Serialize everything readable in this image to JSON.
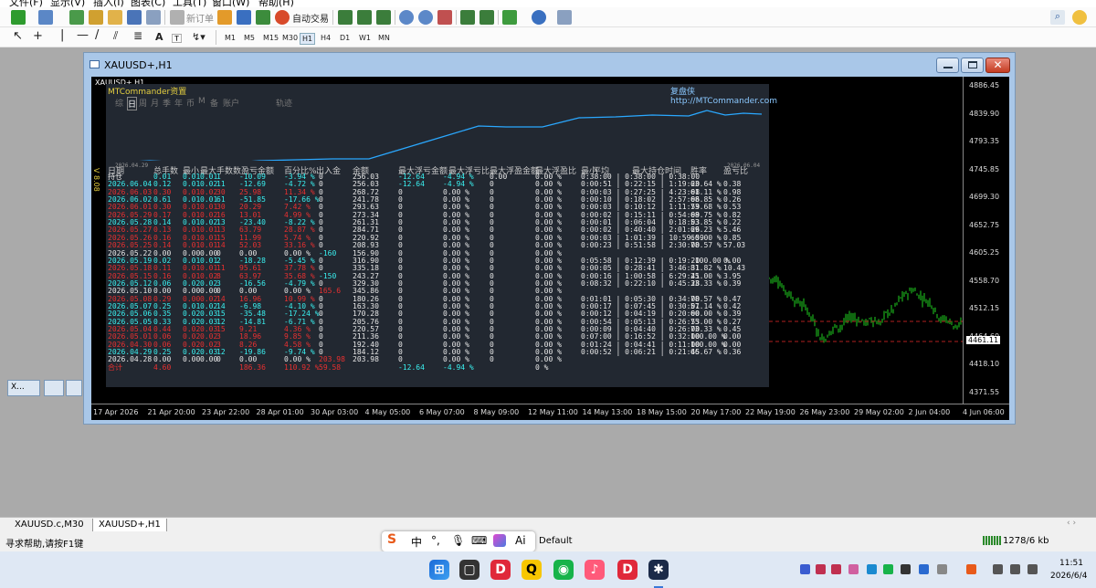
{
  "menu": [
    "文件(F)",
    "显示(V)",
    "插入(I)",
    "图表(C)",
    "工具(T)",
    "窗口(W)",
    "帮助(H)"
  ],
  "toolbar": {
    "new_order": "新订单",
    "auto_trading": "自动交易",
    "timeframes": [
      "M1",
      "M5",
      "M15",
      "M30",
      "H1",
      "H4",
      "D1",
      "W1",
      "MN"
    ],
    "active_timeframe": "H1",
    "text_tool": "A"
  },
  "chart_window": {
    "title": "XAUUSD+,H1",
    "symbol_label": "XAUUSD+,H1"
  },
  "price_axis": [
    "4886.45",
    "4839.90",
    "4793.35",
    "4745.85",
    "4699.30",
    "4652.75",
    "4605.25",
    "4558.70",
    "4512.15",
    "4464.60",
    "4418.10",
    "4371.55"
  ],
  "price_marker": "4461.11",
  "time_axis": [
    "17 Apr 2026",
    "21 Apr 20:00",
    "23 Apr 22:00",
    "28 Apr 01:00",
    "30 Apr 03:00",
    "4 May 05:00",
    "6 May 07:00",
    "8 May 09:00",
    "12 May 11:00",
    "14 May 13:00",
    "18 May 15:00",
    "20 May 17:00",
    "22 May 19:00",
    "26 May 23:00",
    "29 May 02:00",
    "2 Jun 04:00",
    "4 Jun 06:00"
  ],
  "panel": {
    "title": "MTCommander资置",
    "brand": "复盘侠 http://MTCommander.com",
    "tabs": [
      "综",
      "日",
      "周",
      "月",
      "季",
      "年",
      "币",
      "M",
      "备",
      "账户",
      "轨迹"
    ],
    "curve_start": "2026.04.29",
    "curve_end": "2026.06.04",
    "headers": [
      "日期",
      "总手数",
      "最小",
      "最大",
      "手数",
      "数",
      "盈亏金额",
      "百分比%",
      "出入金",
      "余额",
      "最大浮亏金额",
      "最大浮亏比",
      "最大浮盈金额",
      "最大浮盈比",
      "最小",
      "平均",
      "最大持仓时间",
      "胜率",
      "盈亏比"
    ],
    "rows": [
      {
        "d": "持仓",
        "l": "0.01",
        "mn": "0.01",
        "mx": "0.01",
        "n": "1",
        "pl": "-10.09",
        "pct": "-3.94 %",
        "io": "0",
        "bal": "256.03",
        "fl": "-12.64",
        "flp": "-4.94 %",
        "fp": "0.00",
        "fpp": "0.00 %",
        "t": "0:38:00 | 0:38:00 | 0:38:00",
        "wr": "",
        "rr": "",
        "c": "c"
      },
      {
        "d": "2026.06.04",
        "l": "0.12",
        "mn": "0.01",
        "mx": "0.02",
        "n": "11",
        "pl": "-12.69",
        "pct": "-4.72 %",
        "io": "0",
        "bal": "256.03",
        "fl": "-12.64",
        "flp": "-4.94 %",
        "fp": "0",
        "fpp": "0.00 %",
        "t": "0:00:51 | 0:22:15 | 1:19:20",
        "wr": "63.64 %",
        "rr": "0.38",
        "c": "c"
      },
      {
        "d": "2026.06.03",
        "l": "0.30",
        "mn": "0.01",
        "mx": "0.02",
        "n": "30",
        "pl": "25.98",
        "pct": "11.34 %",
        "io": "0",
        "bal": "268.72",
        "fl": "0",
        "flp": "0.00 %",
        "fp": "0",
        "fpp": "0.00 %",
        "t": "0:00:03 | 0:27:25 | 4:23:08",
        "wr": "61.11 %",
        "rr": "0.98",
        "c": "r"
      },
      {
        "d": "2026.06.02",
        "l": "0.61",
        "mn": "0.01",
        "mx": "0.01",
        "n": "61",
        "pl": "-51.85",
        "pct": "-17.66 %",
        "io": "0",
        "bal": "241.78",
        "fl": "0",
        "flp": "0.00 %",
        "fp": "0",
        "fpp": "0.00 %",
        "t": "0:00:10 | 0:18:02 | 2:57:06",
        "wr": "68.85 %",
        "rr": "0.26",
        "c": "c"
      },
      {
        "d": "2026.06.01",
        "l": "0.30",
        "mn": "0.01",
        "mx": "0.01",
        "n": "30",
        "pl": "20.29",
        "pct": "7.42 %",
        "io": "0",
        "bal": "293.63",
        "fl": "0",
        "flp": "0.00 %",
        "fp": "0",
        "fpp": "0.00 %",
        "t": "0:00:03 | 0:10:12 | 1:11:59",
        "wr": "73.68 %",
        "rr": "0.53",
        "c": "r"
      },
      {
        "d": "2026.05.29",
        "l": "0.17",
        "mn": "0.01",
        "mx": "0.02",
        "n": "16",
        "pl": "13.01",
        "pct": "4.99 %",
        "io": "0",
        "bal": "273.34",
        "fl": "0",
        "flp": "0.00 %",
        "fp": "0",
        "fpp": "0.00 %",
        "t": "0:00:02 | 0:15:11 | 0:54:09",
        "wr": "68.75 %",
        "rr": "0.82",
        "c": "r"
      },
      {
        "d": "2026.05.28",
        "l": "0.14",
        "mn": "0.01",
        "mx": "0.02",
        "n": "13",
        "pl": "-23.40",
        "pct": "-8.22 %",
        "io": "0",
        "bal": "261.31",
        "fl": "0",
        "flp": "0.00 %",
        "fp": "0",
        "fpp": "0.00 %",
        "t": "0:00:01 | 0:06:04 | 0:18:03",
        "wr": "53.85 %",
        "rr": "0.22",
        "c": "c"
      },
      {
        "d": "2026.05.27",
        "l": "0.13",
        "mn": "0.01",
        "mx": "0.01",
        "n": "13",
        "pl": "63.79",
        "pct": "28.87 %",
        "io": "0",
        "bal": "284.71",
        "fl": "0",
        "flp": "0.00 %",
        "fp": "0",
        "fpp": "0.00 %",
        "t": "0:00:02 | 0:40:40 | 2:01:26",
        "wr": "69.23 %",
        "rr": "5.46",
        "c": "r"
      },
      {
        "d": "2026.05.26",
        "l": "0.16",
        "mn": "0.01",
        "mx": "0.01",
        "n": "15",
        "pl": "11.99",
        "pct": "5.74 %",
        "io": "0",
        "bal": "220.92",
        "fl": "0",
        "flp": "0.00 %",
        "fp": "0",
        "fpp": "0.00 %",
        "t": "0:00:03 | 1:01:39 | 10:59:59",
        "wr": "60.00 %",
        "rr": "0.85",
        "c": "r"
      },
      {
        "d": "2026.05.25",
        "l": "0.14",
        "mn": "0.01",
        "mx": "0.01",
        "n": "14",
        "pl": "52.03",
        "pct": "33.16 %",
        "io": "0",
        "bal": "208.93",
        "fl": "0",
        "flp": "0.00 %",
        "fp": "0",
        "fpp": "0.00 %",
        "t": "0:00:23 | 0:51:58 | 2:30:00",
        "wr": "78.57 %",
        "rr": "57.03",
        "c": "r"
      },
      {
        "d": "2026.05.22",
        "l": "0.00",
        "mn": "0.00",
        "mx": "0.00",
        "n": "0",
        "pl": "0.00",
        "pct": "0.00 %",
        "io": "-160",
        "bal": "156.90",
        "fl": "0",
        "flp": "0.00 %",
        "fp": "0",
        "fpp": "0.00 %",
        "t": "",
        "wr": "",
        "rr": "",
        "c": "w"
      },
      {
        "d": "2026.05.19",
        "l": "0.02",
        "mn": "0.01",
        "mx": "0.01",
        "n": "2",
        "pl": "-18.28",
        "pct": "-5.45 %",
        "io": "0",
        "bal": "316.90",
        "fl": "0",
        "flp": "0.00 %",
        "fp": "0",
        "fpp": "0.00 %",
        "t": "0:05:58 | 0:12:39 | 0:19:20",
        "wr": "-100.00 %",
        "rr": "0.00",
        "c": "c"
      },
      {
        "d": "2026.05.18",
        "l": "0.11",
        "mn": "0.01",
        "mx": "0.01",
        "n": "11",
        "pl": "95.61",
        "pct": "37.78 %",
        "io": "0",
        "bal": "335.18",
        "fl": "0",
        "flp": "0.00 %",
        "fp": "0",
        "fpp": "0.00 %",
        "t": "0:00:05 | 0:28:41 | 3:46:31",
        "wr": "81.82 %",
        "rr": "10.43",
        "c": "r"
      },
      {
        "d": "2026.05.15",
        "l": "0.16",
        "mn": "0.01",
        "mx": "0.02",
        "n": "8",
        "pl": "63.97",
        "pct": "35.68 %",
        "io": "-150",
        "bal": "243.27",
        "fl": "0",
        "flp": "0.00 %",
        "fp": "0",
        "fpp": "0.00 %",
        "t": "0:00:16 | 1:00:58 | 6:29:41",
        "wr": "25.00 %",
        "rr": "3.95",
        "c": "r"
      },
      {
        "d": "2026.05.12",
        "l": "0.06",
        "mn": "0.02",
        "mx": "0.02",
        "n": "3",
        "pl": "-16.56",
        "pct": "-4.79 %",
        "io": "0",
        "bal": "329.30",
        "fl": "0",
        "flp": "0.00 %",
        "fp": "0",
        "fpp": "0.00 %",
        "t": "0:08:32 | 0:22:10 | 0:45:28",
        "wr": "33.33 %",
        "rr": "0.39",
        "c": "c"
      },
      {
        "d": "2026.05.10",
        "l": "0.00",
        "mn": "0.00",
        "mx": "0.00",
        "n": "0",
        "pl": "0.00",
        "pct": "0.00 %",
        "io": "165.6",
        "bal": "345.86",
        "fl": "0",
        "flp": "0.00 %",
        "fp": "0",
        "fpp": "0.00 %",
        "t": "",
        "wr": "",
        "rr": "",
        "c": "w"
      },
      {
        "d": "2026.05.08",
        "l": "0.29",
        "mn": "0.00",
        "mx": "0.02",
        "n": "14",
        "pl": "16.96",
        "pct": "10.99 %",
        "io": "0",
        "bal": "180.26",
        "fl": "0",
        "flp": "0.00 %",
        "fp": "0",
        "fpp": "0.00 %",
        "t": "0:01:01 | 0:05:30 | 0:34:00",
        "wr": "78.57 %",
        "rr": "0.47",
        "c": "r"
      },
      {
        "d": "2026.05.07",
        "l": "0.25",
        "mn": "0.01",
        "mx": "0.02",
        "n": "14",
        "pl": "-6.98",
        "pct": "-4.10 %",
        "io": "0",
        "bal": "163.30",
        "fl": "0",
        "flp": "0.00 %",
        "fp": "0",
        "fpp": "0.00 %",
        "t": "0:00:17 | 0:07:45 | 0:30:01",
        "wr": "57.14 %",
        "rr": "0.42",
        "c": "c"
      },
      {
        "d": "2026.05.06",
        "l": "0.35",
        "mn": "0.02",
        "mx": "0.03",
        "n": "15",
        "pl": "-35.48",
        "pct": "-17.24 %",
        "io": "0",
        "bal": "170.28",
        "fl": "0",
        "flp": "0.00 %",
        "fp": "0",
        "fpp": "0.00 %",
        "t": "0:00:12 | 0:04:19 | 0:20:00",
        "wr": "60.00 %",
        "rr": "0.39",
        "c": "c"
      },
      {
        "d": "2026.05.05",
        "l": "0.33",
        "mn": "0.02",
        "mx": "0.03",
        "n": "12",
        "pl": "-14.81",
        "pct": "-6.71 %",
        "io": "0",
        "bal": "205.76",
        "fl": "0",
        "flp": "0.00 %",
        "fp": "0",
        "fpp": "0.00 %",
        "t": "0:00:54 | 0:05:13 | 0:26:53",
        "wr": "75.00 %",
        "rr": "0.27",
        "c": "c"
      },
      {
        "d": "2026.05.04",
        "l": "0.44",
        "mn": "0.02",
        "mx": "0.03",
        "n": "15",
        "pl": "9.21",
        "pct": "4.36 %",
        "io": "0",
        "bal": "220.57",
        "fl": "0",
        "flp": "0.00 %",
        "fp": "0",
        "fpp": "0.00 %",
        "t": "0:00:09 | 0:04:40 | 0:26:00",
        "wr": "73.33 %",
        "rr": "0.45",
        "c": "r"
      },
      {
        "d": "2026.05.01",
        "l": "0.06",
        "mn": "0.02",
        "mx": "0.02",
        "n": "3",
        "pl": "18.96",
        "pct": "9.85 %",
        "io": "0",
        "bal": "211.36",
        "fl": "0",
        "flp": "0.00 %",
        "fp": "0",
        "fpp": "0.00 %",
        "t": "0:07:00 | 0:16:52 | 0:32:00",
        "wr": "100.00 %",
        "rr": "0.00",
        "c": "r"
      },
      {
        "d": "2026.04.30",
        "l": "0.06",
        "mn": "0.02",
        "mx": "0.02",
        "n": "3",
        "pl": "8.26",
        "pct": "4.58 %",
        "io": "0",
        "bal": "192.40",
        "fl": "0",
        "flp": "0.00 %",
        "fp": "0",
        "fpp": "0.00 %",
        "t": "0:01:24 | 0:04:41 | 0:11:00",
        "wr": "100.00 %",
        "rr": "0.00",
        "c": "r"
      },
      {
        "d": "2026.04.29",
        "l": "0.25",
        "mn": "0.02",
        "mx": "0.03",
        "n": "12",
        "pl": "-19.86",
        "pct": "-9.74 %",
        "io": "0",
        "bal": "184.12",
        "fl": "0",
        "flp": "0.00 %",
        "fp": "0",
        "fpp": "0.00 %",
        "t": "0:00:52 | 0:06:21 | 0:21:45",
        "wr": "66.67 %",
        "rr": "0.36",
        "c": "c"
      },
      {
        "d": "2026.04.28",
        "l": "0.00",
        "mn": "0.00",
        "mx": "0.00",
        "n": "0",
        "pl": "0.00",
        "pct": "0.00 %",
        "io": "203.98",
        "bal": "203.98",
        "fl": "0",
        "flp": "0.00 %",
        "fp": "0",
        "fpp": "0.00 %",
        "t": "",
        "wr": "",
        "rr": "",
        "c": "w"
      },
      {
        "d": "合计",
        "l": "4.60",
        "mn": "",
        "mx": "",
        "n": "",
        "pl": "186.36",
        "pct": "110.92 %",
        "io": "59.58",
        "bal": "",
        "fl": "-12.64",
        "flp": "-4.94 %",
        "fp": "",
        "fpp": "0 %",
        "t": "",
        "wr": "",
        "rr": "",
        "c": "r"
      }
    ]
  },
  "bottom_tabs": [
    "XAUUSD.c,M30",
    "XAUUSD+,H1"
  ],
  "status": {
    "help": "寻求帮助,请按F1键",
    "profile": "Default",
    "traffic": "1278/6 kb"
  },
  "ime": {
    "label1": "中",
    "label2": "°,",
    "label3": "Ai"
  },
  "clock": {
    "time": "11:51",
    "date": "2026/6/4"
  },
  "minimized": {
    "label": "X..."
  }
}
